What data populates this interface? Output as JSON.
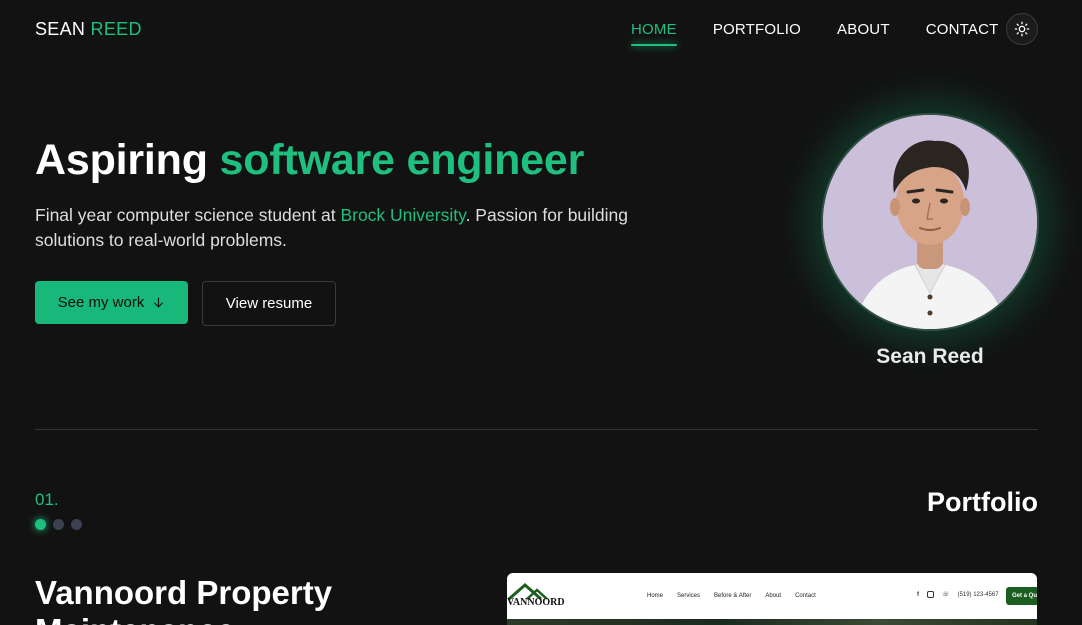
{
  "nav": {
    "brand_first": "SEAN",
    "brand_second": "REED",
    "links": [
      "HOME",
      "PORTFOLIO",
      "ABOUT",
      "CONTACT"
    ],
    "active_link": "HOME",
    "theme_toggle_icon": "sun-icon"
  },
  "hero": {
    "title_plain": "Aspiring",
    "title_accent": "software engineer",
    "sub_before": "Final year computer science student at ",
    "sub_link": "Brock University",
    "sub_after": ". Passion for building solutions to real-world problems.",
    "primary_button": "See my work",
    "primary_button_icon": "arrow-down-icon",
    "secondary_button": "View resume",
    "avatar_name": "Sean Reed"
  },
  "portfolio": {
    "number": "01.",
    "heading": "Portfolio",
    "dots_count": 3,
    "active_dot": 0,
    "project_title": "Vannoord Property Maintenance",
    "preview": {
      "logo_text": "VANNOORD",
      "links": [
        "Home",
        "Services",
        "Before & After",
        "About",
        "Contact"
      ],
      "phone": "(519) 123-4567",
      "cta": "Get a Qu"
    }
  },
  "colors": {
    "accent": "#1fbf7f",
    "background": "#121212",
    "button_primary": "#17b87a"
  }
}
